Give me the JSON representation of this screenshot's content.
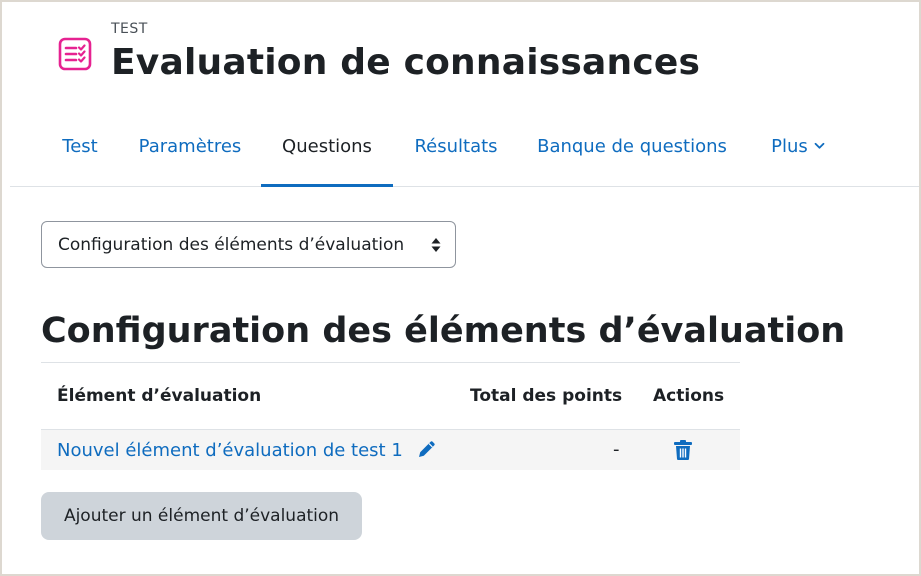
{
  "header": {
    "subtitle": "TEST",
    "title": "Evaluation de connaissances",
    "icon": "quiz-checklist-icon",
    "icon_color": "#e62291"
  },
  "tabs": [
    {
      "label": "Test",
      "active": false
    },
    {
      "label": "Paramètres",
      "active": false
    },
    {
      "label": "Questions",
      "active": true
    },
    {
      "label": "Résultats",
      "active": false
    },
    {
      "label": "Banque de questions",
      "active": false
    },
    {
      "label": "Plus",
      "active": false,
      "has_dropdown": true
    }
  ],
  "selector": {
    "selected": "Configuration des éléments d’évaluation"
  },
  "section": {
    "title": "Configuration des éléments d’évaluation"
  },
  "table": {
    "columns": [
      "Élément d’évaluation",
      "Total des points",
      "Actions"
    ],
    "rows": [
      {
        "item": "Nouvel élément d’évaluation de test 1",
        "points": "-",
        "actions": [
          "edit-icon",
          "trash-icon"
        ]
      }
    ]
  },
  "add_button": {
    "label": "Ajouter un élément d’évaluation"
  },
  "colors": {
    "link": "#0f6cbf",
    "text": "#1d2125",
    "accent": "#0f6cbf"
  }
}
